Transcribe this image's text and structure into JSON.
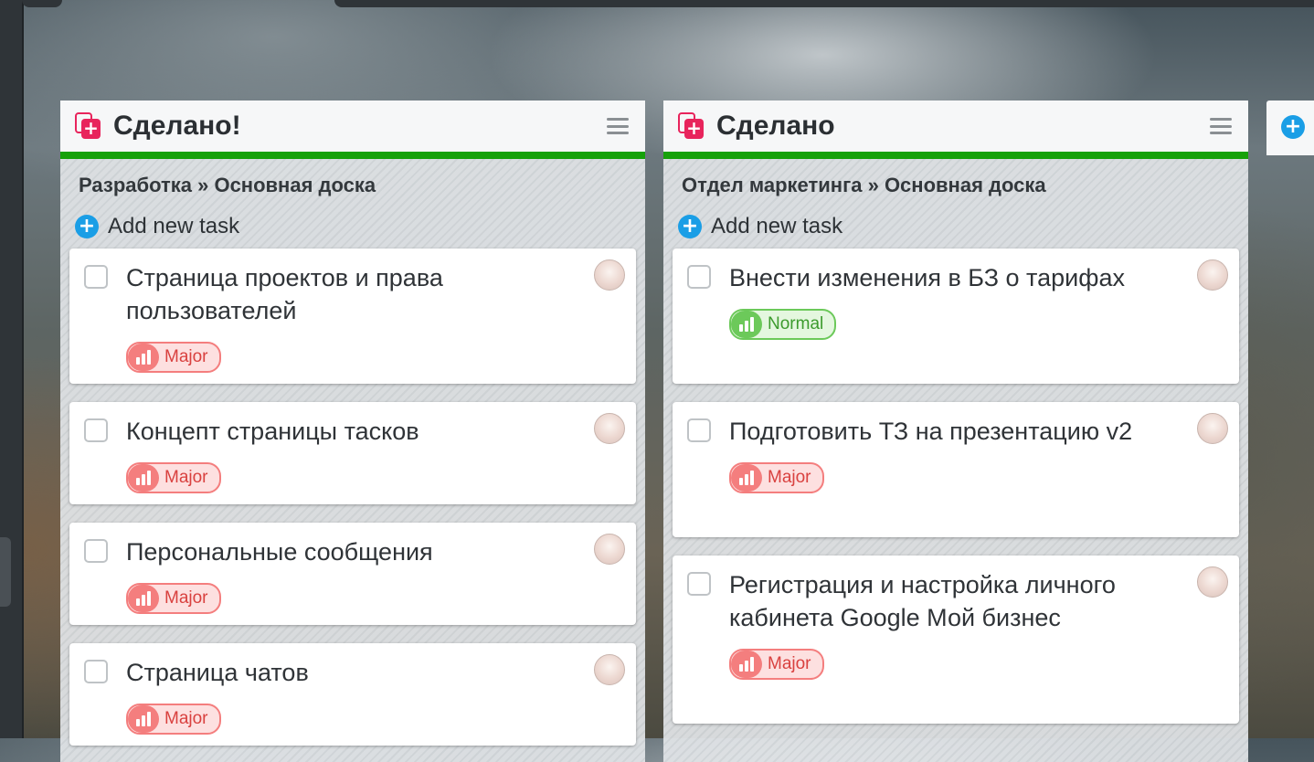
{
  "columns": [
    {
      "title": "Сделано!",
      "breadcrumb": "Разработка » Основная доска",
      "add_task_label": "Add new task",
      "cards": [
        {
          "title": "Страница проектов и права пользователей",
          "priority": "Major"
        },
        {
          "title": "Концепт страницы тасков",
          "priority": "Major"
        },
        {
          "title": "Персональные сообщения",
          "priority": "Major"
        },
        {
          "title": "Страница чатов",
          "priority": "Major"
        }
      ]
    },
    {
      "title": "Сделано",
      "breadcrumb": "Отдел маркетинга » Основная доска",
      "add_task_label": "Add new task",
      "cards": [
        {
          "title": "Внести изменения в БЗ о тарифах",
          "priority": "Normal"
        },
        {
          "title": "Подготовить ТЗ на презентацию v2",
          "priority": "Major"
        },
        {
          "title": "Регистрация и настройка личного кабинета Google Мой бизнес",
          "priority": "Major"
        }
      ]
    }
  ],
  "colors": {
    "done_bar": "#17a10a",
    "accent_icon": "#e8245c",
    "add_icon": "#1a9ee6",
    "major": "#f47e7e",
    "normal": "#6cc95a"
  },
  "icons": {
    "column": "board-icon",
    "menu": "menu-icon",
    "add": "plus-icon",
    "priority": "priority-bars-icon"
  }
}
